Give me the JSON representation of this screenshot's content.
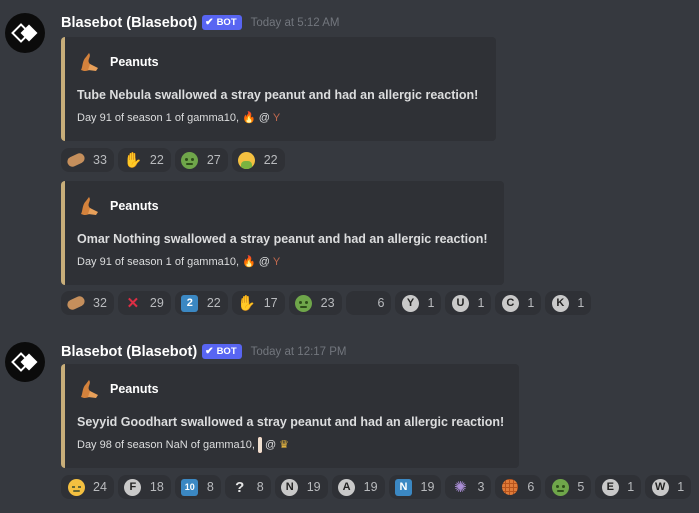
{
  "messages": [
    {
      "author": "Blasebot (Blasebot)",
      "bot_tag": "BOT",
      "timestamp": "Today at 5:12 AM",
      "show_header": true,
      "embed": {
        "author_name": "Peanuts",
        "description": "Tube Nebula swallowed a stray peanut and had an allergic reaction!",
        "footer": "Day 91 of season 1 of gamma10,",
        "footer_sep": "@",
        "footer_icons": [
          "fire-icon",
          "antler-icon"
        ]
      },
      "reactions": [
        {
          "icon": "peanut-icon",
          "count": "33"
        },
        {
          "icon": "peanut-hand-icon",
          "count": "22"
        },
        {
          "icon": "nauseated-face-icon",
          "count": "27"
        },
        {
          "icon": "vomiting-face-icon",
          "count": "22"
        }
      ]
    },
    {
      "show_header": false,
      "embed": {
        "author_name": "Peanuts",
        "description": "Omar Nothing swallowed a stray peanut and had an allergic reaction!",
        "footer": "Day 91 of season 1 of gamma10,",
        "footer_sep": "@",
        "footer_icons": [
          "fire-icon",
          "antler-icon"
        ]
      },
      "reactions": [
        {
          "icon": "peanut-icon",
          "count": "32"
        },
        {
          "icon": "cross-mark-icon",
          "count": "29"
        },
        {
          "icon": "keycap-2-icon",
          "label": "2",
          "count": "22"
        },
        {
          "icon": "peanut-hand-icon",
          "count": "17"
        },
        {
          "icon": "nauseated-face-icon",
          "count": "23"
        },
        {
          "icon": "blank-emoji-icon",
          "count": "6"
        },
        {
          "icon": "letter-y-icon",
          "label": "Y",
          "count": "1"
        },
        {
          "icon": "letter-u-icon",
          "label": "U",
          "count": "1"
        },
        {
          "icon": "letter-c-icon",
          "label": "C",
          "count": "1"
        },
        {
          "icon": "letter-k-icon",
          "label": "K",
          "count": "1"
        }
      ]
    },
    {
      "author": "Blasebot (Blasebot)",
      "bot_tag": "BOT",
      "timestamp": "Today at 12:17 PM",
      "show_header": true,
      "embed": {
        "author_name": "Peanuts",
        "description": "Seyyid Goodhart swallowed a stray peanut and had an allergic reaction!",
        "footer": "Day 98 of season NaN of gamma10,",
        "footer_sep": "@",
        "footer_icons": [
          "meat-icon",
          "crown-icon"
        ]
      },
      "reactions": [
        {
          "icon": "relieved-face-icon",
          "count": "24"
        },
        {
          "icon": "letter-f-icon",
          "label": "F",
          "count": "18"
        },
        {
          "icon": "keycap-10-icon",
          "label": "10",
          "count": "8"
        },
        {
          "icon": "question-mark-icon",
          "label": "?",
          "count": "8"
        },
        {
          "icon": "letter-n-icon",
          "label": "N",
          "count": "19"
        },
        {
          "icon": "letter-a-icon",
          "label": "A",
          "count": "19"
        },
        {
          "icon": "keycap-n-icon",
          "label": "N",
          "count": "19"
        },
        {
          "icon": "virus-icon",
          "count": "3"
        },
        {
          "icon": "waffle-icon",
          "count": "6"
        },
        {
          "icon": "nauseated-face-icon",
          "count": "5"
        },
        {
          "icon": "letter-e-icon",
          "label": "E",
          "count": "1"
        },
        {
          "icon": "letter-w-icon",
          "label": "W",
          "count": "1"
        }
      ]
    }
  ]
}
